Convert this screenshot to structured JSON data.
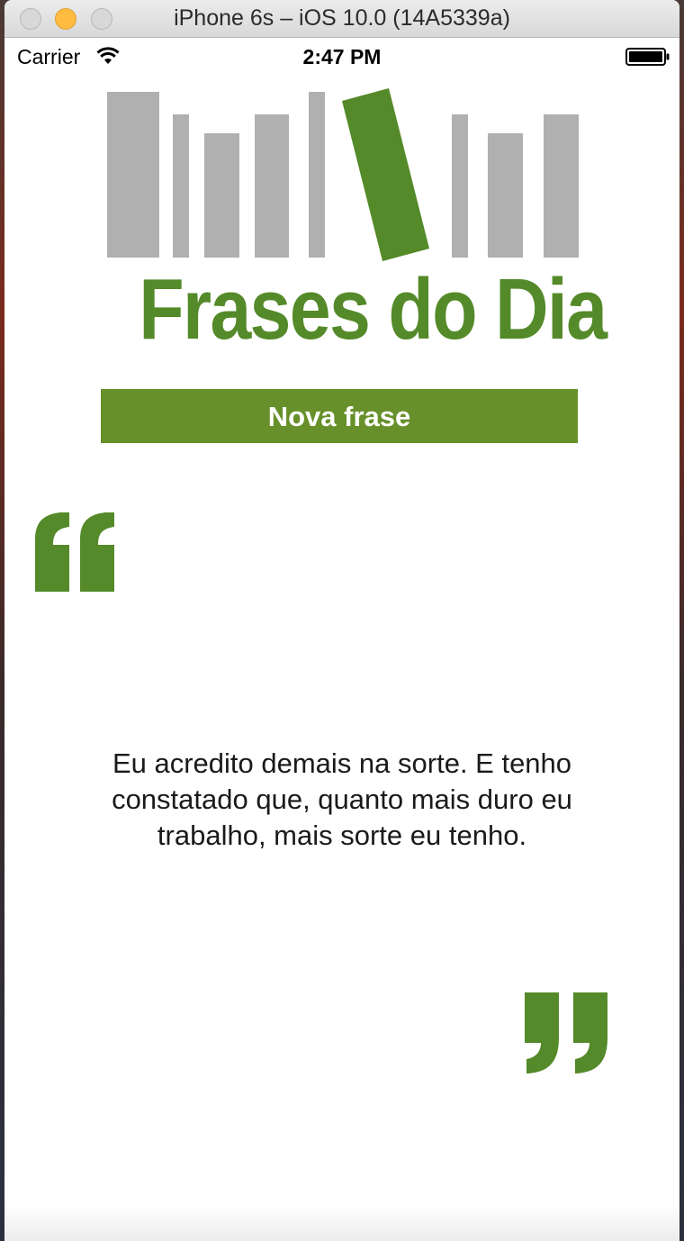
{
  "window": {
    "title": "iPhone 6s – iOS 10.0 (14A5339a)"
  },
  "status_bar": {
    "carrier": "Carrier",
    "time": "2:47 PM"
  },
  "logo": {
    "text": "Frases do Dia",
    "bar_color": "#b0b0b0",
    "accent_color": "#548a29"
  },
  "button": {
    "label": "Nova frase",
    "color": "#67902a"
  },
  "quote": {
    "text": "Eu acredito demais na sorte. E tenho constatado que, quanto mais duro eu trabalho, mais sorte eu tenho.",
    "mark_color": "#548a29"
  }
}
